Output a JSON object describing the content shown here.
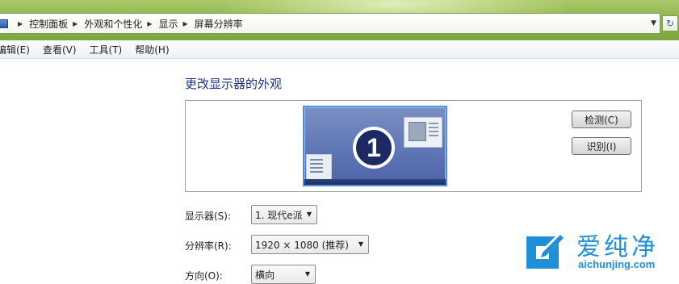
{
  "address_bar": {
    "breadcrumbs": [
      "控制面板",
      "外观和个性化",
      "显示",
      "屏幕分辨率"
    ]
  },
  "menu": {
    "items": [
      "编辑(E)",
      "查看(V)",
      "工具(T)",
      "帮助(H)"
    ]
  },
  "main": {
    "title": "更改显示器的外观",
    "preview": {
      "monitor_number": "1"
    },
    "detect_button": "检测(C)",
    "identify_button": "识别(I)",
    "display": {
      "label": "显示器(S):",
      "value": "1. 现代e派"
    },
    "resolution": {
      "label": "分辨率(R):",
      "value": "1920 × 1080 (推荐)"
    },
    "orientation": {
      "label": "方向(O):",
      "value": "横向"
    }
  },
  "watermark": {
    "name": "爱纯净",
    "url": "aichunjing.com"
  },
  "colors": {
    "chrome_green": "#8fb64f",
    "title_blue": "#1e3287",
    "monitor_border": "#4a8fe0",
    "watermark_blue": "#1f8fd8"
  },
  "icons": [
    "computer-icon",
    "chevron-right-icon",
    "dropdown-arrow-icon",
    "refresh-icon",
    "monitor-preview-icon"
  ]
}
